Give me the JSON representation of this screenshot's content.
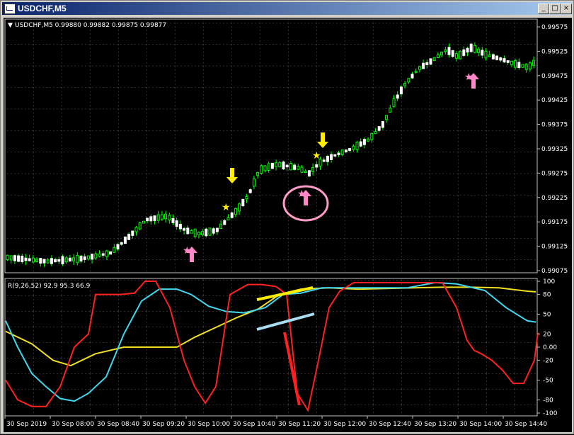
{
  "window": {
    "title": "USDCHF,M5",
    "minimize_glyph": "_",
    "maximize_glyph": "□",
    "close_glyph": "×"
  },
  "main_panel": {
    "header": "USDCHF,M5  0.99880 0.99882 0.99875 0.99877",
    "price_levels": [
      "0.99575",
      "0.99525",
      "0.99475",
      "0.99425",
      "0.99375",
      "0.99325",
      "0.99275",
      "0.99225",
      "0.99175",
      "0.99125",
      "0.99075"
    ],
    "candle_color": "#00ff00",
    "background": "#000000"
  },
  "indicator_panel": {
    "header": "R(9,26,52) 92.9 95.3 66.9",
    "levels": [
      "100",
      "80",
      "50",
      "20",
      "0.00",
      "-20",
      "-50",
      "-80",
      "-100"
    ],
    "series_colors": {
      "fast": "#ff2020",
      "mid": "#40d8f0",
      "slow": "#f0e020"
    }
  },
  "time_axis": {
    "labels": [
      "30 Sep 2019",
      "30 Sep 08:00",
      "30 Sep 08:40",
      "30 Sep 09:20",
      "30 Sep 10:00",
      "30 Sep 10:40",
      "30 Sep 11:20",
      "30 Sep 12:00",
      "30 Sep 12:40",
      "30 Sep 13:20",
      "30 Sep 14:00",
      "30 Sep 14:40"
    ]
  },
  "markers": {
    "up_arrow_color": "#ff88c8",
    "down_arrow_color": "#ffee00",
    "star_color": "#ffee00",
    "star_pink_color": "#ff88c8"
  }
}
